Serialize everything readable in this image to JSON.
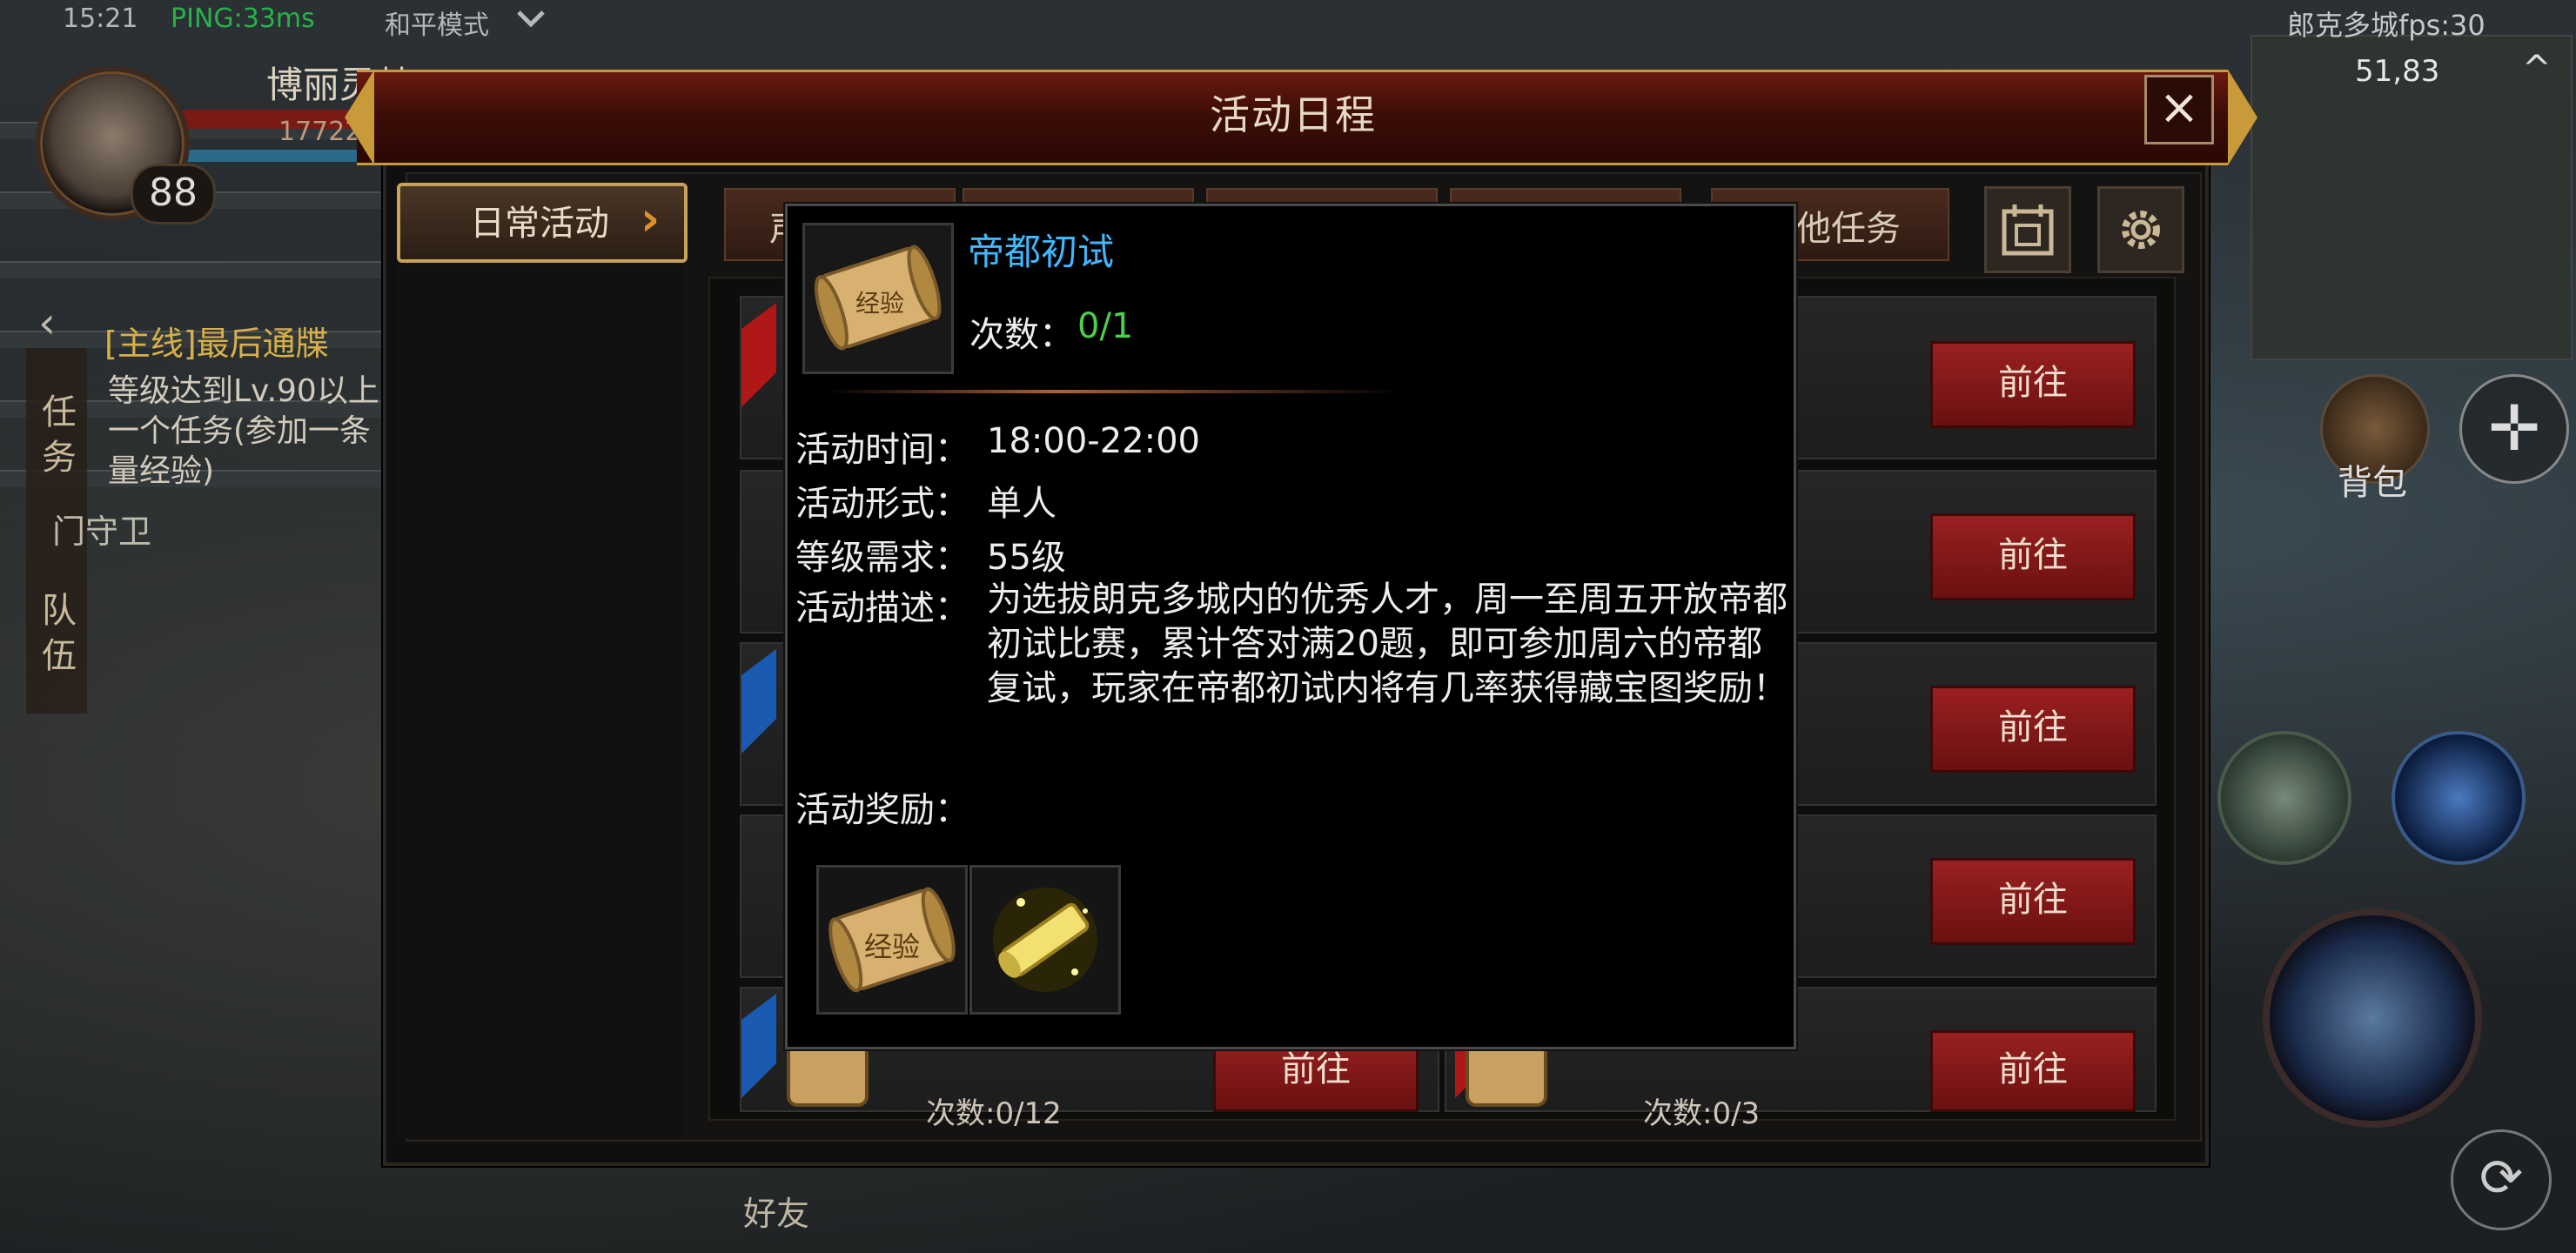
{
  "hud": {
    "time": "15:21",
    "ping": "PING:33ms",
    "mode": "和平模式",
    "player_name": "博丽灵梦",
    "player_hp": "17722",
    "level": "88",
    "fps": "郎克多城fps:30",
    "coords": "51,83",
    "bag": "背包",
    "friends": "好友",
    "quest_tab": "任务",
    "team_tab": "队伍",
    "quest_title": "[主线]最后通牒",
    "quest_lines": [
      "等级达到Lv.90以上",
      "一个任务(参加一条",
      "量经验)"
    ],
    "guard": "门守卫"
  },
  "modal": {
    "title": "活动日程",
    "close": "×",
    "nav_daily": "日常活动",
    "tabs": [
      "声望",
      "",
      "",
      "",
      "其他任务"
    ],
    "go_label": "前往",
    "row_counts": [
      "次数:0/12",
      "次数:0/3"
    ]
  },
  "tooltip": {
    "name": "帝都初试",
    "icon_text": "经验",
    "count_label": "次数：",
    "count_value": "0/1",
    "time_label": "活动时间：",
    "time_value": "18:00-22:00",
    "form_label": "活动形式：",
    "form_value": "单人",
    "level_label": "等级需求：",
    "level_value": "55级",
    "desc_label": "活动描述：",
    "desc_value": "为选拔朗克多城内的优秀人才，周一至周五开放帝都初试比赛，累计答对满20题，即可参加周六的帝都复试，玩家在帝都初试内将有几率获得藏宝图奖励！",
    "reward_label": "活动奖励：",
    "rewards": [
      "经验",
      "scroll"
    ]
  },
  "colors": {
    "title_bar": "#5a140c",
    "accent_gold": "#c89a3a",
    "tooltip_name": "#3fb8ff",
    "count_green": "#4ad04a",
    "go_button": "#8a1818"
  }
}
